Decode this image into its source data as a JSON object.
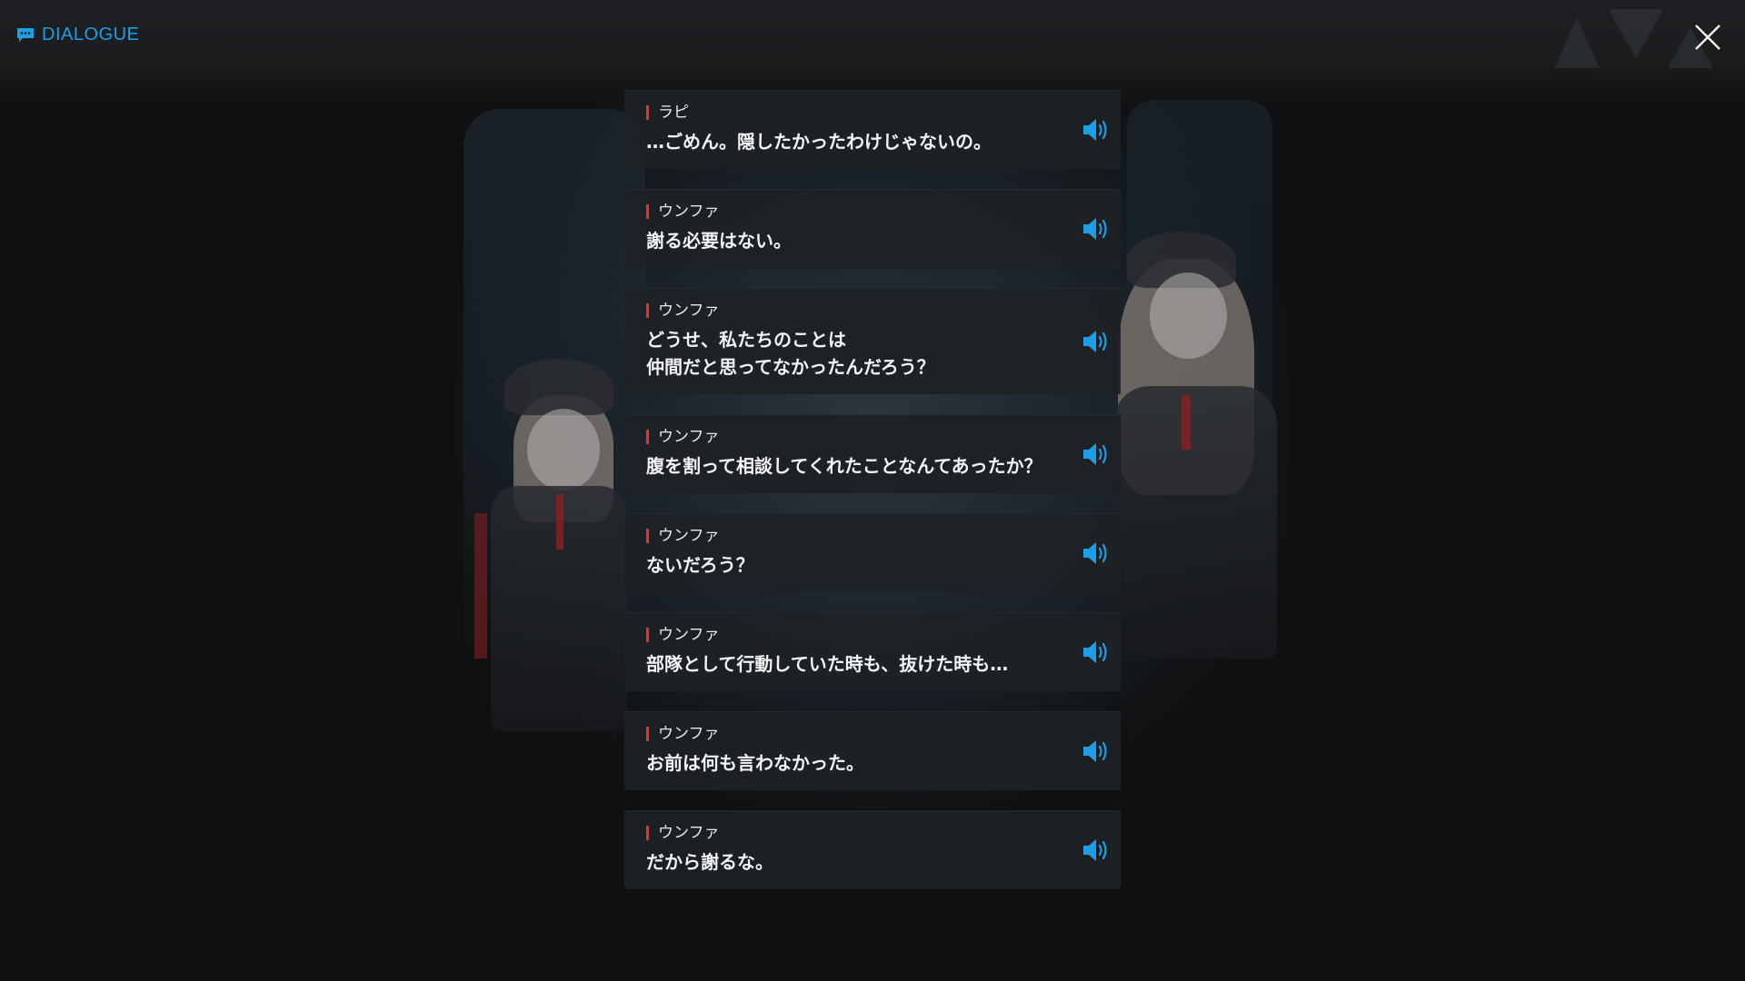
{
  "header": {
    "title": "DIALOGUE",
    "title_icon": "chat-bubble-icon",
    "close_icon": "close-icon"
  },
  "colors": {
    "accent": "#1e9ee6",
    "speaker_marker": "#e3342f",
    "card_bg": "#1e2125"
  },
  "dialogue": [
    {
      "speaker": "ラピ",
      "line": "…ごめん。隠したかったわけじゃないの。"
    },
    {
      "speaker": "ウンファ",
      "line": "謝る必要はない。"
    },
    {
      "speaker": "ウンファ",
      "line": "どうせ、私たちのことは\n仲間だと思ってなかったんだろう？"
    },
    {
      "speaker": "ウンファ",
      "line": "腹を割って相談してくれたことなんてあったか？"
    },
    {
      "speaker": "ウンファ",
      "line": "ないだろう？"
    },
    {
      "speaker": "ウンファ",
      "line": "部隊として行動していた時も、抜けた時も…"
    },
    {
      "speaker": "ウンファ",
      "line": "お前は何も言わなかった。"
    },
    {
      "speaker": "ウンファ",
      "line": "だから謝るな。"
    }
  ]
}
